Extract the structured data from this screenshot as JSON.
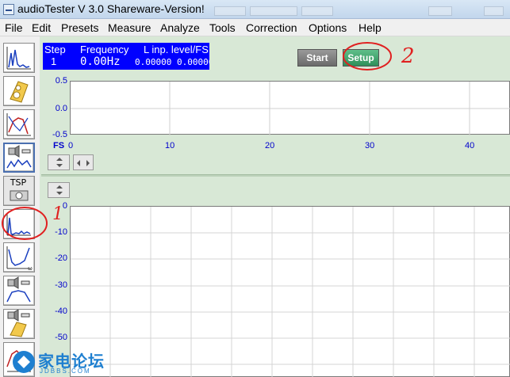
{
  "window": {
    "title": "audioTester  V 3.0 Shareware-Version!"
  },
  "menu": [
    "File",
    "Edit",
    "Presets",
    "Measure",
    "Analyze",
    "Tools",
    "Correction",
    "Options",
    "Help"
  ],
  "status_panel": {
    "step_label": "Step",
    "step_value": "1",
    "frequency_label": "Frequency",
    "frequency_value": "0.00Hz",
    "level_label": "L inp. level/FS",
    "level_value": "0.00000 0.00000"
  },
  "buttons": {
    "start": "Start",
    "setup": "Setup"
  },
  "top_plot": {
    "y_ticks": [
      "0.5",
      "0.0",
      "-0.5"
    ],
    "x_unit": "FS",
    "x_ticks": [
      "0",
      "10",
      "20",
      "30",
      "40"
    ]
  },
  "bottom_plot": {
    "y_ticks": [
      "0",
      "-10",
      "-20",
      "-30",
      "-40",
      "-50"
    ]
  },
  "left_toolbar": {
    "tsp_label": "TSP",
    "icons": [
      "spectrum-icon",
      "speaker-box-icon",
      "frequency-response-icon",
      "speaker-sweep-icon",
      "tsp-icon",
      "fft-spectrum-icon",
      "impedance-icon",
      "speaker-bandpass-icon",
      "speaker-enclosure-icon",
      "phase-icon"
    ]
  },
  "annotations": {
    "marker_1": "1",
    "marker_2": "2"
  },
  "watermark": {
    "text": "家电论坛",
    "sub": "JDBBS.COM"
  },
  "colors": {
    "status_panel_bg": "#0000ff",
    "plot_label": "#0000cc",
    "setup_button": "#2f8f5a",
    "annotation": "#e02020",
    "main_bg": "#d8e8d6"
  }
}
